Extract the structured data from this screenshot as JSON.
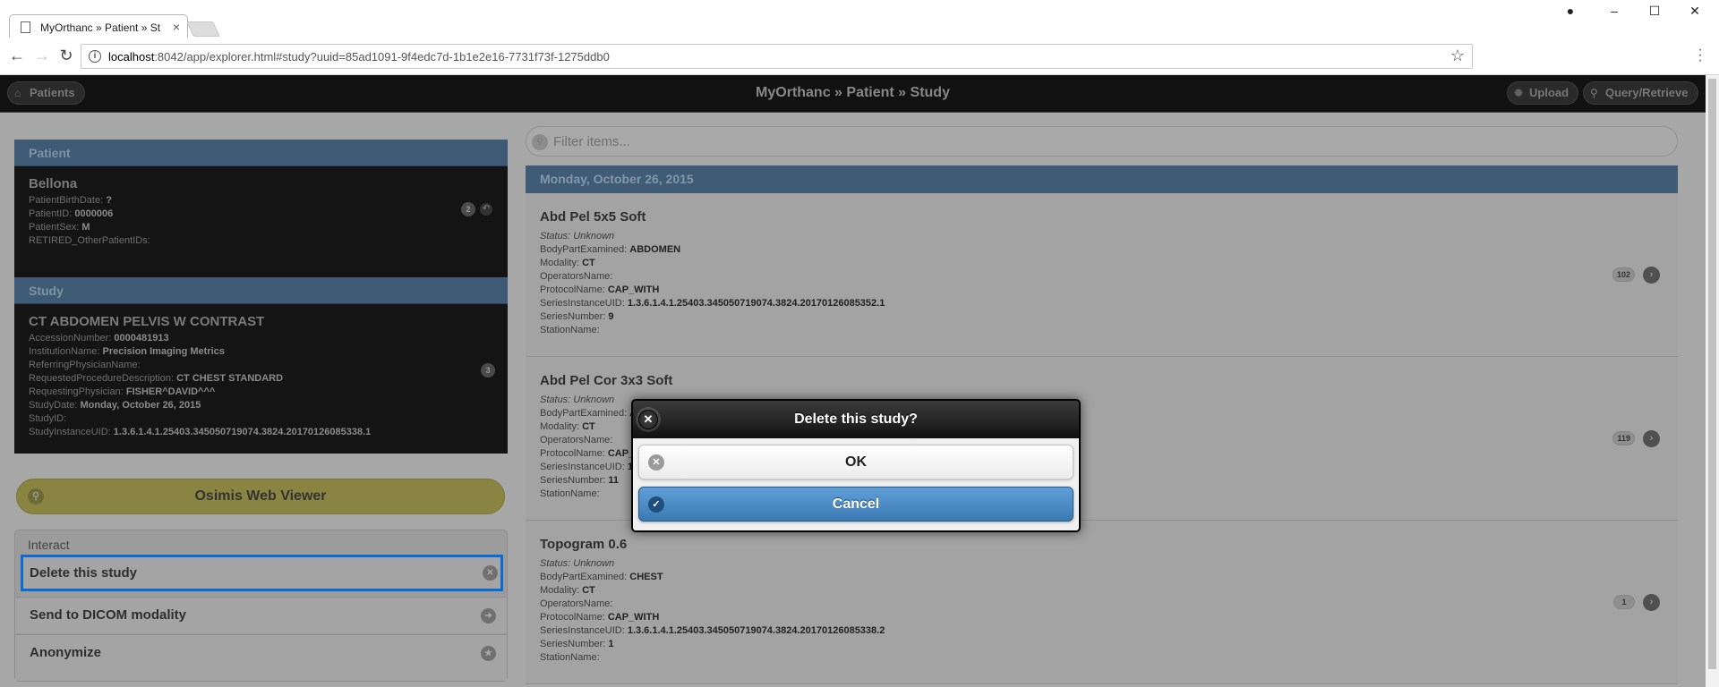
{
  "browser": {
    "tab_title": "MyOrthanc » Patient » St",
    "url_host": "localhost",
    "url_rest": ":8042/app/explorer.html#study?uuid=85ad1091-9f4edc7d-1b1e2e16-7731f73f-1275ddb0"
  },
  "header": {
    "patients_label": "Patients",
    "title": "MyOrthanc » Patient » Study",
    "upload_label": "Upload",
    "query_label": "Query/Retrieve"
  },
  "patient": {
    "section_label": "Patient",
    "name": "Bellona",
    "birthdate_label": "PatientBirthDate:",
    "birthdate": "?",
    "id_label": "PatientID:",
    "id": "0000006",
    "sex_label": "PatientSex:",
    "sex": "M",
    "other_ids_label": "RETIRED_OtherPatientIDs:",
    "count": "2"
  },
  "study": {
    "section_label": "Study",
    "name": "CT ABDOMEN PELVIS W CONTRAST",
    "fields": [
      {
        "label": "AccessionNumber:",
        "value": "0000481913"
      },
      {
        "label": "InstitutionName:",
        "value": "Precision Imaging Metrics"
      },
      {
        "label": "ReferringPhysicianName:",
        "value": ""
      },
      {
        "label": "RequestedProcedureDescription:",
        "value": "CT CHEST STANDARD"
      },
      {
        "label": "RequestingPhysician:",
        "value": "FISHER^DAVID^^^"
      },
      {
        "label": "StudyDate:",
        "value": "Monday, October 26, 2015"
      },
      {
        "label": "StudyID:",
        "value": ""
      },
      {
        "label": "StudyInstanceUID:",
        "value": "1.3.6.1.4.1.25403.345050719074.3824.20170126085338.1"
      }
    ],
    "count": "3"
  },
  "viewer_button": "Osimis Web Viewer",
  "interact": {
    "header": "Interact",
    "delete": "Delete this study",
    "send": "Send to DICOM modality",
    "anonymize": "Anonymize"
  },
  "filter": {
    "placeholder": "Filter items..."
  },
  "date_header": "Monday, October 26, 2015",
  "series": [
    {
      "name": "Abd Pel 5x5 Soft",
      "status": "Status: Unknown",
      "fields": [
        {
          "label": "BodyPartExamined:",
          "value": "ABDOMEN"
        },
        {
          "label": "Modality:",
          "value": "CT"
        },
        {
          "label": "OperatorsName:",
          "value": ""
        },
        {
          "label": "ProtocolName:",
          "value": "CAP_WITH"
        },
        {
          "label": "SeriesInstanceUID:",
          "value": "1.3.6.1.4.1.25403.345050719074.3824.20170126085352.1"
        },
        {
          "label": "SeriesNumber:",
          "value": "9"
        },
        {
          "label": "StationName:",
          "value": ""
        }
      ],
      "count": "102"
    },
    {
      "name": "Abd Pel Cor 3x3 Soft",
      "status": "Status: Unknown",
      "fields": [
        {
          "label": "BodyPartExamined:",
          "value": "ABDOMEN"
        },
        {
          "label": "Modality:",
          "value": "CT"
        },
        {
          "label": "OperatorsName:",
          "value": ""
        },
        {
          "label": "ProtocolName:",
          "value": "CAP_WITH"
        },
        {
          "label": "SeriesInstanceUID:",
          "value": "1.3.6.1.4.1.25403.345050719074.3824.20170126085352.2"
        },
        {
          "label": "SeriesNumber:",
          "value": "11"
        },
        {
          "label": "StationName:",
          "value": ""
        }
      ],
      "count": "119"
    },
    {
      "name": "Topogram 0.6",
      "status": "Status: Unknown",
      "fields": [
        {
          "label": "BodyPartExamined:",
          "value": "CHEST"
        },
        {
          "label": "Modality:",
          "value": "CT"
        },
        {
          "label": "OperatorsName:",
          "value": ""
        },
        {
          "label": "ProtocolName:",
          "value": "CAP_WITH"
        },
        {
          "label": "SeriesInstanceUID:",
          "value": "1.3.6.1.4.1.25403.345050719074.3824.20170126085338.2"
        },
        {
          "label": "SeriesNumber:",
          "value": "1"
        },
        {
          "label": "StationName:",
          "value": ""
        }
      ],
      "count": "1"
    }
  ],
  "dialog": {
    "title": "Delete this study?",
    "ok": "OK",
    "cancel": "Cancel"
  },
  "colors": {
    "header_blue": "#3f5b75",
    "selection_border": "#0a6bd6",
    "cancel_blue": "#3b79b3"
  }
}
